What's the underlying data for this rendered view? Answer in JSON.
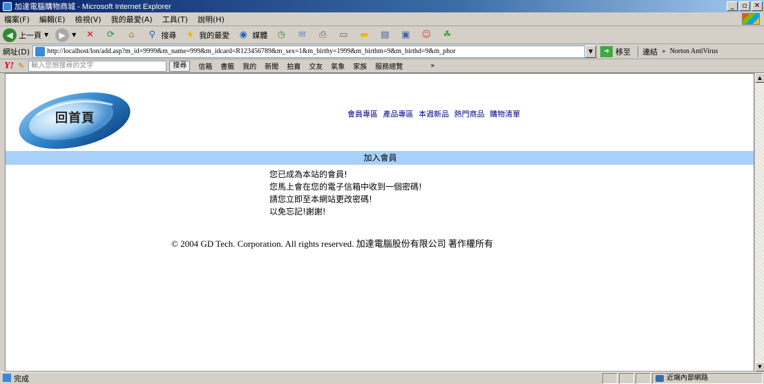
{
  "window": {
    "title": "加達電腦購物商城 - Microsoft Internet Explorer",
    "buttons": [
      "_",
      "▫",
      "✕"
    ]
  },
  "menu": [
    "檔案(F)",
    "編輯(E)",
    "檢視(V)",
    "我的最愛(A)",
    "工具(T)",
    "說明(H)"
  ],
  "toolbar": {
    "back": "上一頁",
    "search": "搜尋",
    "favorites": "我的最愛",
    "media": "媒體"
  },
  "address": {
    "label": "網址(D)",
    "url": "http://localhost/lon/add.asp?m_id=9999&m_name=999&m_idcard=R123456789&m_sex=1&m_birthy=1999&m_birthm=9&m_birthd=9&m_phor",
    "go": "移至",
    "links": "連結",
    "chevron": "»",
    "norton": "Norton AntiVirus"
  },
  "yahoo": {
    "logo": "Y!",
    "placeholder": "輸入您想搜尋的文字",
    "search_btn": "搜尋",
    "items": [
      "信箱",
      "書籤",
      "我的",
      "新聞",
      "拍賣",
      "交友",
      "氣象",
      "家族",
      "服務總覽"
    ],
    "more": "»"
  },
  "page": {
    "logo_text": "回首頁",
    "nav": [
      "會員專區",
      "產品專區",
      "本週新品",
      "熱門商品",
      "購物清單"
    ],
    "banner": "加入會員",
    "messages": [
      "您已成為本站的會員!",
      "您馬上會在您的電子信箱中收到一個密碼!",
      "請您立即至本網站更改密碼!",
      "以免忘記!謝謝!"
    ],
    "copyright": "© 2004 GD Tech. Corporation. All rights reserved. 加達電腦股份有限公司 著作權所有"
  },
  "status": {
    "text": "完成",
    "zone": "近端內部網路"
  }
}
